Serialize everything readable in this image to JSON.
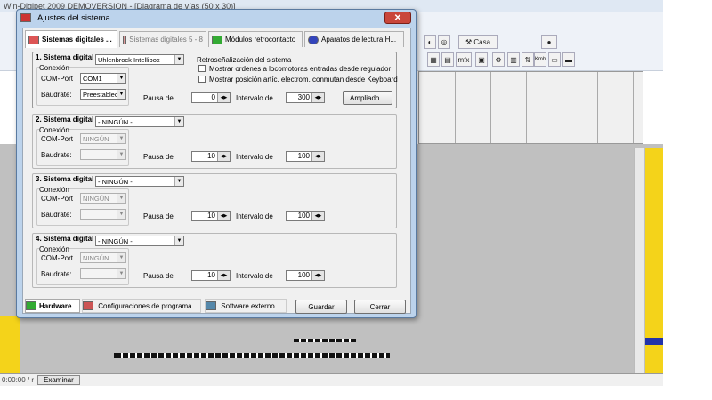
{
  "app": {
    "title": "Win-Digipet 2009 DEMOVERSION - [Diagrama de vías (50 x 30)]",
    "toolbar": {
      "casa_label": "Casa",
      "mfx_label": "mfx",
      "kmh_label": "Kmh"
    },
    "status": {
      "left_text": "0:00:00 / r",
      "button_label": "Examinar"
    }
  },
  "dialog": {
    "title": "Ajustes del sistema",
    "close_label": "✕",
    "tabs": [
      {
        "label": "Sistemas digitales ...",
        "active": true
      },
      {
        "label": "Sistemas digitales 5 - 8",
        "active": false
      },
      {
        "label": "Módulos retrocontacto",
        "active": false
      },
      {
        "label": "Aparatos de lectura H...",
        "active": false
      }
    ],
    "common": {
      "conexion": "Conexión",
      "com_port": "COM-Port",
      "baudrate": "Baudrate:",
      "pausa": "Pausa de",
      "intervalo": "Intervalo de"
    },
    "systems": [
      {
        "title": "1. Sistema digital",
        "system": "Uhlenbrock Intellibox",
        "port": "COM1",
        "baud": "Preestablec",
        "pausa": "0",
        "intervalo": "300",
        "feedback": {
          "title": "Retroseñalización del sistema",
          "opt1": "Mostrar ordenes a locomotoras entradas desde regulador",
          "opt2": "Mostrar posición artíc. electrom. conmutan desde Keyboard"
        },
        "ampliado": "Ampliado..."
      },
      {
        "title": "2. Sistema digital",
        "system": "- NINGÚN -",
        "port": "NINGÚN",
        "baud": "",
        "pausa": "10",
        "intervalo": "100"
      },
      {
        "title": "3. Sistema digital",
        "system": "- NINGÚN -",
        "port": "NINGÚN",
        "baud": "",
        "pausa": "10",
        "intervalo": "100"
      },
      {
        "title": "4. Sistema digital",
        "system": "- NINGÚN -",
        "port": "NINGÚN",
        "baud": "",
        "pausa": "10",
        "intervalo": "100"
      }
    ],
    "bottom": {
      "hardware": "Hardware",
      "config": "Configuraciones de programa",
      "software": "Software externo",
      "guardar": "Guardar",
      "cerrar": "Cerrar"
    }
  }
}
